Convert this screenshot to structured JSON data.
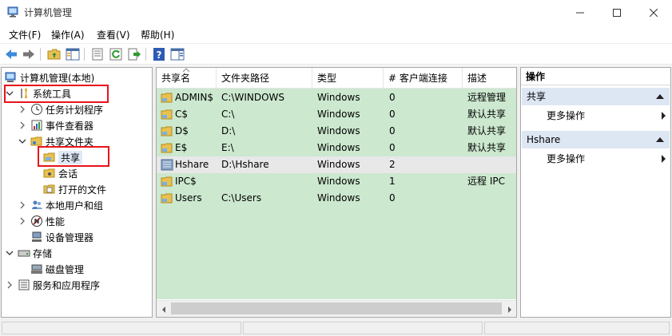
{
  "window": {
    "title": "计算机管理"
  },
  "menu": [
    "文件(F)",
    "操作(A)",
    "查看(V)",
    "帮助(H)"
  ],
  "toolbar": {
    "icons": [
      "back-icon",
      "forward-icon",
      "up-folder-icon",
      "show-tree-icon",
      "properties-icon",
      "refresh-icon",
      "export-list-icon",
      "help-icon",
      "show-action-pane-icon"
    ]
  },
  "tree": {
    "root": "计算机管理(本地)",
    "system_tools": "系统工具",
    "task_scheduler": "任务计划程序",
    "event_viewer": "事件查看器",
    "shared_folders": "共享文件夹",
    "shares": "共享",
    "sessions": "会话",
    "open_files": "打开的文件",
    "local_users": "本地用户和组",
    "performance": "性能",
    "device_manager": "设备管理器",
    "storage": "存储",
    "disk_management": "磁盘管理",
    "services": "服务和应用程序"
  },
  "list": {
    "columns": [
      "共享名",
      "文件夹路径",
      "类型",
      "# 客户端连接",
      "描述"
    ],
    "rows": [
      {
        "name": "ADMIN$",
        "path": "C:\\WINDOWS",
        "type": "Windows",
        "clients": "0",
        "desc": "远程管理"
      },
      {
        "name": "C$",
        "path": "C:\\",
        "type": "Windows",
        "clients": "0",
        "desc": "默认共享"
      },
      {
        "name": "D$",
        "path": "D:\\",
        "type": "Windows",
        "clients": "0",
        "desc": "默认共享"
      },
      {
        "name": "E$",
        "path": "E:\\",
        "type": "Windows",
        "clients": "0",
        "desc": "默认共享"
      },
      {
        "name": "Hshare",
        "path": "D:\\Hshare",
        "type": "Windows",
        "clients": "2",
        "desc": ""
      },
      {
        "name": "IPC$",
        "path": "",
        "type": "Windows",
        "clients": "1",
        "desc": "远程 IPC"
      },
      {
        "name": "Users",
        "path": "C:\\Users",
        "type": "Windows",
        "clients": "0",
        "desc": ""
      }
    ]
  },
  "actions": {
    "header": "操作",
    "section1": "共享",
    "more1": "更多操作",
    "section2": "Hshare",
    "more2": "更多操作"
  },
  "colors": {
    "list_bg": "#cce8cf",
    "selected_row": "#e8e8e8",
    "highlight_box": "#e8141b",
    "action_section_bg": "#dde6f3"
  }
}
